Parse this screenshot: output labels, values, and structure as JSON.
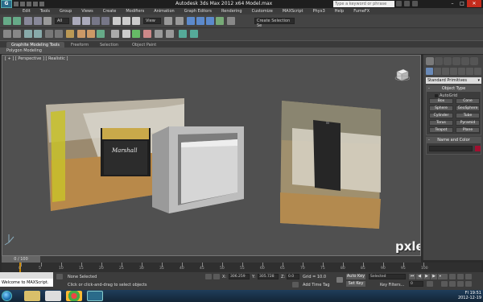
{
  "app": {
    "title": "Autodesk 3ds Max 2012 x64      Model.max",
    "search_placeholder": "Type a keyword or phrase"
  },
  "menu": [
    "Edit",
    "Tools",
    "Group",
    "Views",
    "Create",
    "Modifiers",
    "Animation",
    "Graph Editors",
    "Rendering",
    "Customize",
    "MAXScript",
    "Phyx3",
    "Help",
    "FumeFX"
  ],
  "toolbar": {
    "selection_filter": "All",
    "view_dropdown": "View",
    "named_selection": "Create Selection Se"
  },
  "ribbon": {
    "tabs": [
      "Graphite Modeling Tools",
      "Freeform",
      "Selection",
      "Object Paint"
    ],
    "active_tab": 0,
    "sub_label": "Polygon Modeling"
  },
  "viewport": {
    "label": "[ + ] [ Perspective ] [ Realistic ]"
  },
  "command_panel": {
    "category": "Standard Primitives",
    "object_type_header": "Object Type",
    "autogrid_label": "AutoGrid",
    "buttons": [
      "Box",
      "Cone",
      "Sphere",
      "GeoSphere",
      "Cylinder",
      "Tube",
      "Torus",
      "Pyramid",
      "Teapot",
      "Plane"
    ],
    "name_color_header": "Name and Color"
  },
  "timeline": {
    "slider_label": "0 / 100",
    "ticks": [
      "0",
      "5",
      "10",
      "15",
      "20",
      "25",
      "30",
      "35",
      "40",
      "45",
      "50",
      "55",
      "60",
      "65",
      "70",
      "75",
      "80",
      "85",
      "90",
      "95",
      "100"
    ]
  },
  "status": {
    "maxscript_text": "Welcome to MAXScript.",
    "selection_status": "None Selected",
    "prompt": "Click or click-and-drag to select objects",
    "x_label": "X:",
    "y_label": "Y:",
    "z_label": "Z:",
    "x_value": "306.259",
    "y_value": "305.728",
    "z_value": "0.0",
    "grid": "Grid = 10.0",
    "add_time_tag": "Add Time Tag",
    "auto_key": "Auto Key",
    "set_key": "Set Key",
    "key_mode": "Selected",
    "key_filters": "Key Filters...",
    "frame": "0"
  },
  "taskbar": {
    "lang": "FI",
    "time": "19:51",
    "date": "2012-12-19"
  },
  "watermark": "pxleyes.com",
  "colors": {
    "viewport_bg": "#505050",
    "accent_red": "#c42b1c",
    "swatch": "#a01030"
  }
}
